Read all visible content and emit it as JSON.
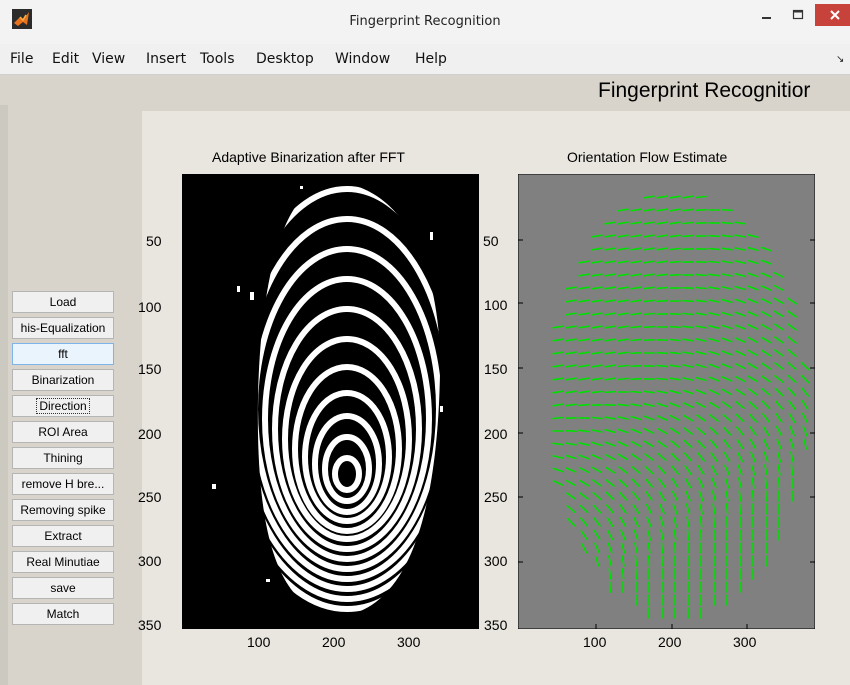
{
  "window": {
    "title": "Fingerprint Recognition",
    "icon": "matlab-icon",
    "controls": [
      "minimize-icon",
      "maximize-icon",
      "close-icon"
    ]
  },
  "menu": {
    "items": [
      "File",
      "Edit",
      "View",
      "Insert",
      "Tools",
      "Desktop",
      "Window",
      "Help"
    ],
    "dock_glyph": "↘"
  },
  "figure": {
    "heading": "Fingerprint Recognitior"
  },
  "buttons": [
    {
      "label": "Load"
    },
    {
      "label": "his-Equalization"
    },
    {
      "label": "fft"
    },
    {
      "label": "Binarization"
    },
    {
      "label": "Direction"
    },
    {
      "label": "ROI Area"
    },
    {
      "label": "Thining"
    },
    {
      "label": "remove H bre..."
    },
    {
      "label": "Removing spike"
    },
    {
      "label": "Extract"
    },
    {
      "label": "Real Minutiae"
    },
    {
      "label": "save"
    },
    {
      "label": "Match"
    }
  ],
  "axes_left": {
    "title": "Adaptive Binarization after FFT",
    "xticks": [
      "100",
      "200",
      "300"
    ],
    "yticks": [
      "50",
      "100",
      "150",
      "200",
      "250",
      "300",
      "350"
    ]
  },
  "axes_right": {
    "title": "Orientation Flow Estimate",
    "xticks": [
      "100",
      "200",
      "300"
    ],
    "yticks": [
      "50",
      "100",
      "150",
      "200",
      "250",
      "300",
      "350"
    ]
  },
  "colors": {
    "figure_bg": "#d8d4cb",
    "flow_bg": "#808080",
    "flow_lines": "#00e000",
    "close_button": "#c7423b"
  }
}
